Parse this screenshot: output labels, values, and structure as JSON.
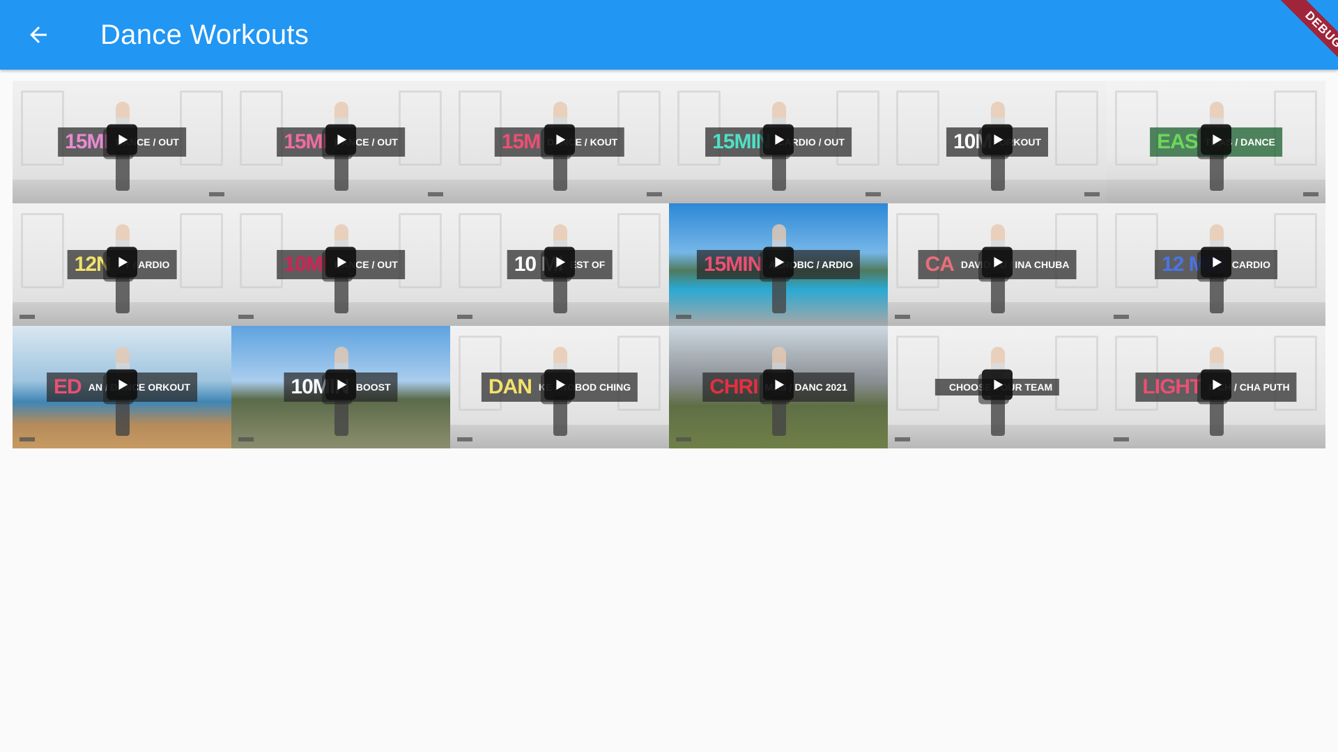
{
  "app_bar": {
    "title": "Dance Workouts",
    "back_icon": "arrow-back-icon",
    "color": "#2196f3"
  },
  "debug_banner": {
    "label": "DEBUG",
    "color": "#a0253a"
  },
  "grid": {
    "columns": 6,
    "tiles": [
      {
        "caption_big": "15MI",
        "caption_small": "DANCE / OUT",
        "accent": "#e88ad3",
        "scene": "room"
      },
      {
        "caption_big": "15MI",
        "caption_small": "DANCE / OUT",
        "accent": "#f06ba1",
        "scene": "room"
      },
      {
        "caption_big": "15M",
        "caption_small": "DANCE / KOUT",
        "accent": "#ec4f74",
        "scene": "room"
      },
      {
        "caption_big": "15MIN",
        "caption_small": "CARDIO / OUT",
        "accent": "#4fe0c6",
        "scene": "room"
      },
      {
        "caption_big": "10M",
        "caption_small": "ORKOUT",
        "accent": "#ffffff",
        "scene": "room"
      },
      {
        "caption_big": "EAS",
        "caption_small": "TMAS / DANCE",
        "accent": "#6bd85a",
        "scene": "xmas"
      },
      {
        "caption_big": "12N",
        "caption_small": "PY / ARDIO",
        "accent": "#f3e36a",
        "scene": "room"
      },
      {
        "caption_big": "10MI",
        "caption_small": "DANCE / OUT",
        "accent": "#d22255",
        "scene": "room"
      },
      {
        "caption_big": "10 MI",
        "caption_small": "EST OF",
        "accent": "#ffffff",
        "scene": "room"
      },
      {
        "caption_big": "15MIN",
        "caption_small": "AEROBIC / ARDIO",
        "accent": "#ec4f74",
        "scene": "pool"
      },
      {
        "caption_big": "CA",
        "caption_small": "DAVID PU / INA CHUBA",
        "accent": "#ec6d7a",
        "scene": "room"
      },
      {
        "caption_big": "12 MIN",
        "caption_small": "CARDIO",
        "accent": "#4a74e8",
        "scene": "room"
      },
      {
        "caption_big": "ED",
        "caption_small": "AN / DANCE ORKOUT",
        "accent": "#ec4f74",
        "scene": "sea"
      },
      {
        "caption_big": "10MIN",
        "caption_small": "BOOST",
        "accent": "#ffffff",
        "scene": "sky"
      },
      {
        "caption_big": "DAN",
        "caption_small": "KE / NOBOD CHING",
        "accent": "#f3e36a",
        "scene": "room"
      },
      {
        "caption_big": "CHRI",
        "caption_small": "MAS / DANC 2021",
        "accent": "#e52f3f",
        "scene": "mountain"
      },
      {
        "caption_big": "",
        "caption_small": "CHOOSE YOUR TEAM",
        "accent": "#ffffff",
        "scene": "room"
      },
      {
        "caption_big": "LIGHT",
        "caption_small": "ITCH / CHA PUTH",
        "accent": "#ec4f74",
        "scene": "room"
      }
    ]
  }
}
